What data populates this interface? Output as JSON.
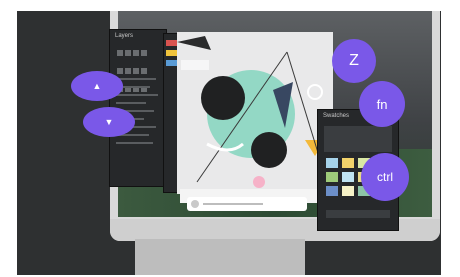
{
  "scene": {
    "background": "#2e3031",
    "accent": "#7a58e8"
  },
  "app_panels": {
    "left_panel_title": "Layers",
    "right_panel_title": "Swatches"
  },
  "keys": [
    {
      "label": "▲",
      "name": "key-up-arrow"
    },
    {
      "label": "▼",
      "name": "key-down-arrow"
    },
    {
      "label": "Z",
      "name": "key-z"
    },
    {
      "label": "fn",
      "name": "key-fn"
    },
    {
      "label": "ctrl",
      "name": "key-ctrl"
    }
  ],
  "artwork": {
    "palette": [
      "#93d8c5",
      "#202122",
      "#f6b2c8",
      "#f3b93a",
      "#e9e9ea"
    ]
  }
}
